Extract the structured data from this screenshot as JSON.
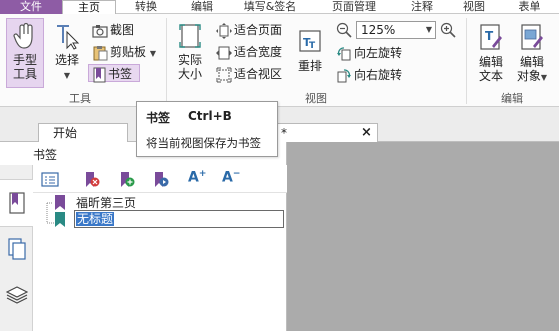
{
  "menubar": {
    "tabs": [
      {
        "label": "文件"
      },
      {
        "label": "主页"
      },
      {
        "label": "转换"
      },
      {
        "label": "编辑"
      },
      {
        "label": "填写&签名"
      },
      {
        "label": "页面管理"
      },
      {
        "label": "注释"
      },
      {
        "label": "视图"
      },
      {
        "label": "表单"
      }
    ]
  },
  "ribbon": {
    "tools": {
      "hand_tool": {
        "line1": "手型",
        "line2": "工具"
      },
      "select": {
        "label": "选择"
      },
      "screenshot": {
        "label": "截图"
      },
      "clipboard": {
        "label": "剪贴板"
      },
      "bookmark": {
        "label": "书签"
      },
      "group_label": "工具"
    },
    "view": {
      "actual_size": {
        "line1": "实际",
        "line2": "大小"
      },
      "fit_page": {
        "label": "适合页面"
      },
      "fit_width": {
        "label": "适合宽度"
      },
      "fit_visible": {
        "label": "适合视区"
      },
      "reflow": {
        "label": "重排"
      },
      "zoom": {
        "value": "125%"
      },
      "rotate_left": {
        "label": "向左旋转"
      },
      "rotate_right": {
        "label": "向右旋转"
      },
      "group_label": "视图"
    },
    "edit": {
      "edit_text": {
        "line1": "编辑",
        "line2": "文本"
      },
      "edit_object": {
        "line1": "编辑",
        "line2": "对象"
      },
      "group_label": "编辑"
    }
  },
  "tooltip": {
    "title": "书签",
    "shortcut": "Ctrl+B",
    "description": "将当前视图保存为书签"
  },
  "tabs": {
    "start": {
      "label": "开始"
    },
    "doc_asterisk": "*",
    "close": "×"
  },
  "panel": {
    "title": "书签",
    "bookmarks": [
      {
        "label": "福昕第三页"
      },
      {
        "label": "无标题"
      }
    ]
  },
  "colors": {
    "accent": "#8e5ca5",
    "selected_btn": "#e8d8f0",
    "bookmark_purple": "#7a4b9a",
    "bookmark_teal": "#2a8a84",
    "view_bg": "#ababab"
  }
}
